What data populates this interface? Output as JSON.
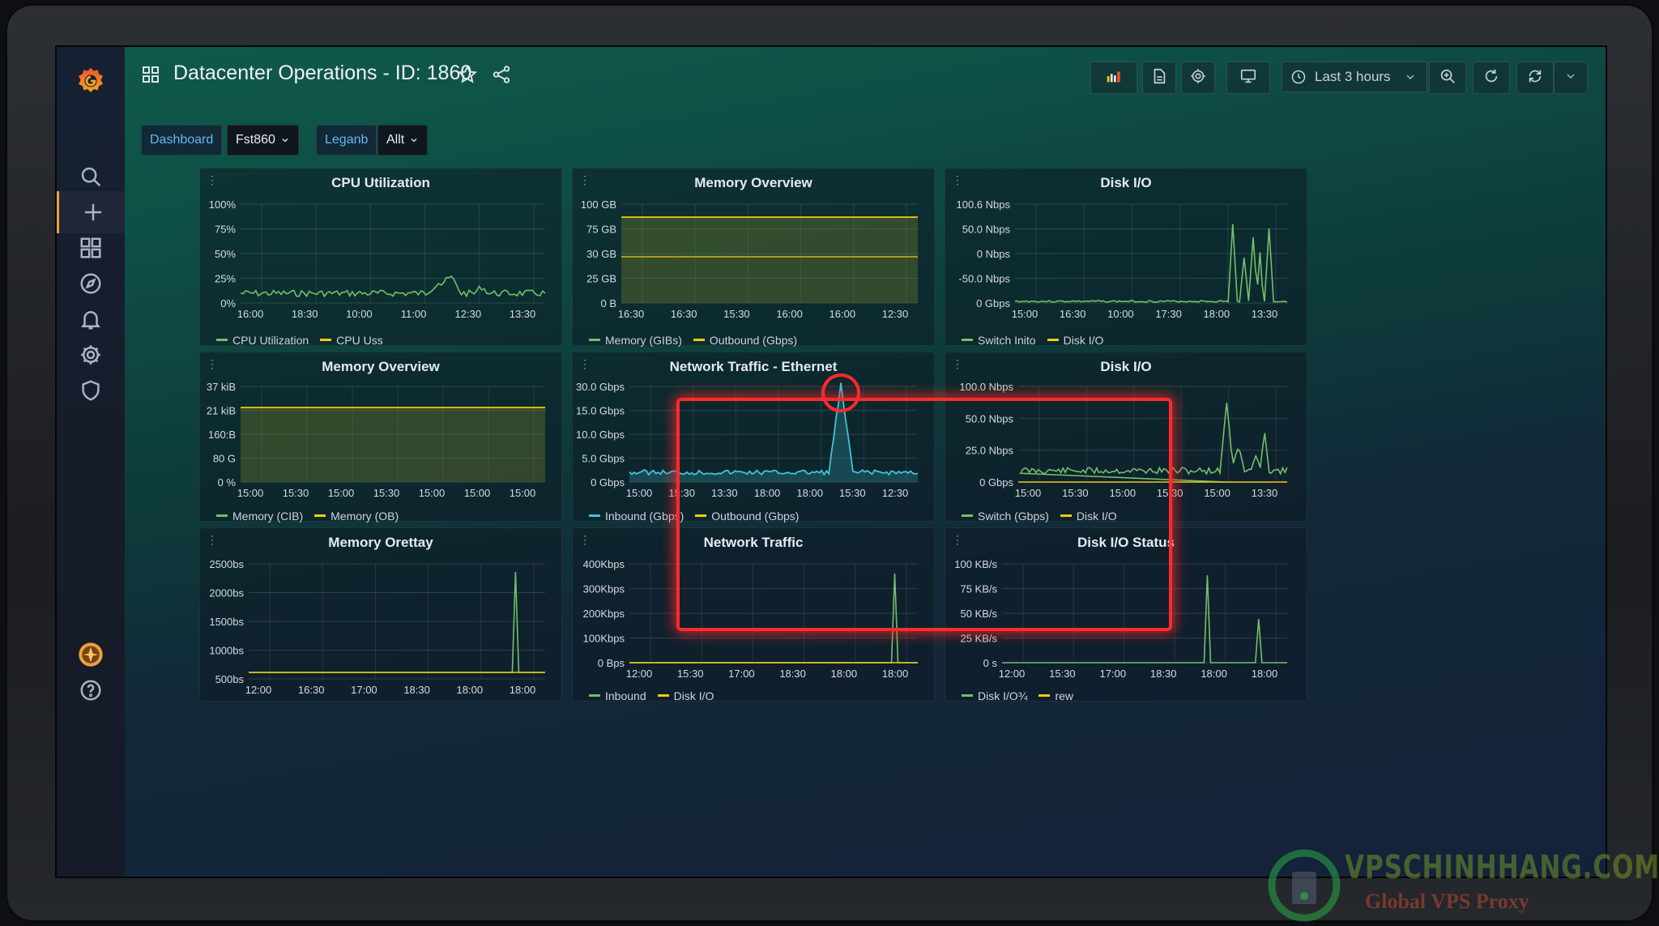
{
  "header": {
    "title": "Datacenter Operations - ID: 1860",
    "time_range": "Last 3 hours"
  },
  "variables": [
    {
      "label": "Dashboard",
      "value": "Fst860"
    },
    {
      "label": "Leganb",
      "value": "Allt"
    }
  ],
  "icons": {
    "logo": "grafana-logo-icon",
    "sidebar": [
      "search-icon",
      "plus-icon",
      "dashboards-icon",
      "explore-compass-icon",
      "alert-bell-icon",
      "gear-icon",
      "shield-icon",
      "avatar-icon",
      "help-icon"
    ],
    "toolbar": [
      "add-panel-icon",
      "save-dashboard-icon",
      "settings-gear-icon",
      "tv-mode-icon",
      "clock-icon",
      "zoom-out-icon",
      "refresh-back-icon",
      "refresh-icon",
      "chevron-down-icon"
    ]
  },
  "colors": {
    "green": "#73bf69",
    "yellow": "#f2cc0c",
    "cyan": "#40c4d6",
    "highlight": "#ff2a2a"
  },
  "watermark": {
    "name": "VPSCHINHHANG.COM",
    "tagline": "Global VPS Proxy"
  },
  "panels": [
    {
      "title": "CPU Utilization",
      "yticks": [
        "100%",
        "75%",
        "50%",
        "25%",
        "0%"
      ],
      "xticks": [
        "16:00",
        "18:30",
        "10:00",
        "11:00",
        "12:30",
        "13:30"
      ],
      "legend": [
        "CPU Utilization",
        "CPU Uss"
      ]
    },
    {
      "title": "Memory Overview",
      "yticks": [
        "100 GB",
        "75 GB",
        "30 GB",
        "25 GB",
        "0 B"
      ],
      "xticks": [
        "16:30",
        "16:30",
        "15:30",
        "16:00",
        "16:00",
        "12:30"
      ],
      "legend": [
        "Memory (GIBs)",
        "Outbound (Gbps)"
      ]
    },
    {
      "title": "Disk I/O",
      "yticks": [
        "100.6 Nbps",
        "50.0 Nbps",
        "0 Nbps",
        "-50.0 Nbps",
        "0 Gbps"
      ],
      "xticks": [
        "15:00",
        "16:30",
        "10:00",
        "17:30",
        "18:00",
        "13:30"
      ],
      "legend": [
        "Switch Inito",
        "Disk I/O"
      ]
    },
    {
      "title": "Memory Overview",
      "yticks": [
        "37 kiB",
        "21 kiB",
        "160:B",
        "80 G",
        "0 %"
      ],
      "xticks": [
        "15:00",
        "15:30",
        "15:00",
        "15:30",
        "15:00",
        "15:00",
        "15:00"
      ],
      "legend": [
        "Memory (CIB)",
        "Memory (OB)"
      ]
    },
    {
      "title": "Network Traffic - Ethernet",
      "yticks": [
        "30.0 Gbps",
        "15.0 Gbps",
        "10.0 Gbps",
        "5.0 Gbps",
        "0 Gbps"
      ],
      "xticks": [
        "15:00",
        "15:30",
        "13:30",
        "18:00",
        "18:00",
        "15:30",
        "12:30"
      ],
      "legend": [
        "Inbound (Gbps)",
        "Outbound (Gbps)"
      ]
    },
    {
      "title": "Disk I/O",
      "yticks": [
        "100.0 Nbps",
        "50.0 Nbps",
        "25.0 Nbps",
        "0 Gbps"
      ],
      "xticks": [
        "15:00",
        "15:30",
        "15:00",
        "15:30",
        "15:00",
        "13:30"
      ],
      "legend": [
        "Switch (Gbps)",
        "Disk I/O"
      ]
    },
    {
      "title": "Memory Orettay",
      "yticks": [
        "2500bs",
        "2000bs",
        "1500bs",
        "1000bs",
        "500bs"
      ],
      "xticks": [
        "12:00",
        "16:30",
        "17:00",
        "18:30",
        "18:00",
        "18:00"
      ],
      "legend": []
    },
    {
      "title": "Network Traffic",
      "yticks": [
        "400Kbps",
        "300Kbps",
        "200Kbps",
        "100Kbps",
        "0 Bps"
      ],
      "xticks": [
        "12:00",
        "15:30",
        "17:00",
        "18:30",
        "18:00",
        "18:00"
      ],
      "legend": [
        "Inbound",
        "Disk I/O"
      ]
    },
    {
      "title": "Disk I/O Status",
      "yticks": [
        "100 KB/s",
        "75 KB/s",
        "50 KB/s",
        "25 KB/s",
        "0 s"
      ],
      "xticks": [
        "12:00",
        "15:30",
        "17:00",
        "18:30",
        "18:00",
        "18:00"
      ],
      "legend": [
        "Disk I/O¾",
        "rew"
      ]
    }
  ]
}
